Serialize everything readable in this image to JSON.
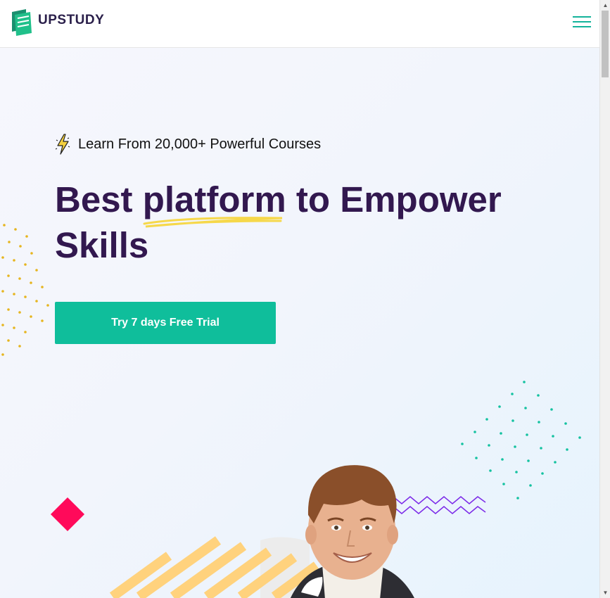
{
  "header": {
    "brand": "UPSTUDY",
    "menu_icon": "hamburger-icon"
  },
  "hero": {
    "tagline": "Learn From 20,000+ Powerful Courses",
    "tagline_icon": "lightning-bolt-icon",
    "headline_before": "Best ",
    "headline_highlight": "platform",
    "headline_after": " to Empower Skills",
    "cta_label": "Try 7 days Free Trial"
  },
  "colors": {
    "brand_green": "#0fbe9b",
    "headline_purple": "#32184f",
    "accent_pink": "#ff0a5a",
    "accent_yellow": "#f4d03f",
    "zigzag_purple": "#7c2ae8"
  }
}
